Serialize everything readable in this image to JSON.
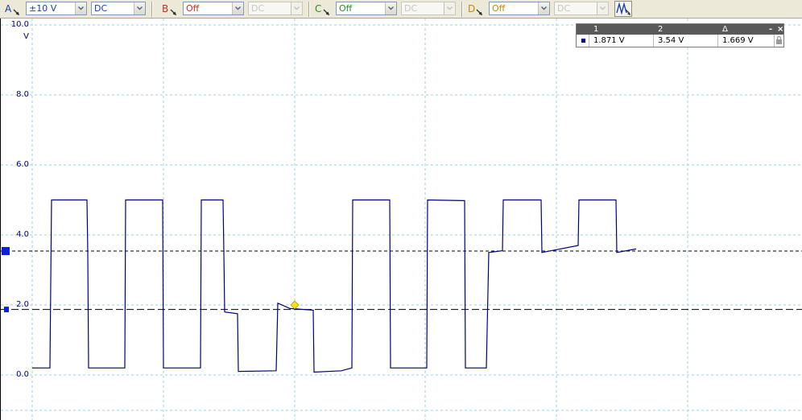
{
  "toolbar": {
    "channels": [
      {
        "letter": "A",
        "color": "#1a3fa6",
        "range": "±10 V",
        "coupling": "DC",
        "range_disabled": false,
        "coupling_disabled": false
      },
      {
        "letter": "B",
        "color": "#c0302a",
        "range": "Off",
        "coupling": "DC",
        "range_disabled": false,
        "coupling_disabled": true
      },
      {
        "letter": "C",
        "color": "#2c8a2c",
        "range": "Off",
        "coupling": "DC",
        "range_disabled": false,
        "coupling_disabled": true
      },
      {
        "letter": "D",
        "color": "#c08a10",
        "range": "Off",
        "coupling": "DC",
        "range_disabled": false,
        "coupling_disabled": true
      }
    ],
    "scope_button_icon": "scope-mode-icon"
  },
  "axis": {
    "ticks": [
      "10.0",
      "8.0",
      "6.0",
      "4.0",
      "2.0",
      "0.0"
    ],
    "unit": "V"
  },
  "ruler_panel": {
    "headers": [
      "1",
      "2",
      "Δ"
    ],
    "values": [
      "1.871 V",
      "3.54 V",
      "1.669 V"
    ],
    "minimize_label": "-",
    "close_label": "×",
    "lock_icon": "lock-icon",
    "channel_marker_color": "#00007f"
  },
  "chart_data": {
    "type": "line",
    "series_color": "#00007f",
    "ylim": [
      -0.2,
      10.0
    ],
    "yticks": [
      0,
      2,
      4,
      6,
      8,
      10
    ],
    "xlim": [
      0,
      996
    ],
    "grid": true,
    "x_gridlines": [
      40,
      203,
      366,
      528,
      691,
      854
    ],
    "rulers": [
      1.871,
      3.54
    ],
    "trigger_level": 2.0,
    "trigger_x": 366,
    "waveform": [
      [
        40,
        0.2
      ],
      [
        62,
        0.2
      ],
      [
        63,
        2.6
      ],
      [
        64,
        5.0
      ],
      [
        108,
        5.0
      ],
      [
        109,
        3.5
      ],
      [
        110,
        0.2
      ],
      [
        155,
        0.2
      ],
      [
        156,
        5.0
      ],
      [
        202,
        5.0
      ],
      [
        203,
        0.2
      ],
      [
        249,
        0.2
      ],
      [
        250,
        5.0
      ],
      [
        277,
        5.0
      ],
      [
        278,
        3.5
      ],
      [
        279,
        1.8
      ],
      [
        295,
        1.75
      ],
      [
        296,
        0.1
      ],
      [
        343,
        0.12
      ],
      [
        345,
        2.05
      ],
      [
        360,
        1.9
      ],
      [
        389,
        1.85
      ],
      [
        390,
        0.08
      ],
      [
        424,
        0.12
      ],
      [
        437,
        0.2
      ],
      [
        438,
        5.0
      ],
      [
        484,
        5.0
      ],
      [
        485,
        0.2
      ],
      [
        530,
        0.2
      ],
      [
        531,
        5.0
      ],
      [
        577,
        4.98
      ],
      [
        578,
        0.2
      ],
      [
        604,
        0.2
      ],
      [
        607,
        3.5
      ],
      [
        624,
        3.55
      ],
      [
        625,
        5.0
      ],
      [
        672,
        5.0
      ],
      [
        673,
        3.5
      ],
      [
        718,
        3.7
      ],
      [
        719,
        5.0
      ],
      [
        765,
        5.0
      ],
      [
        766,
        3.5
      ],
      [
        790,
        3.6
      ]
    ]
  }
}
